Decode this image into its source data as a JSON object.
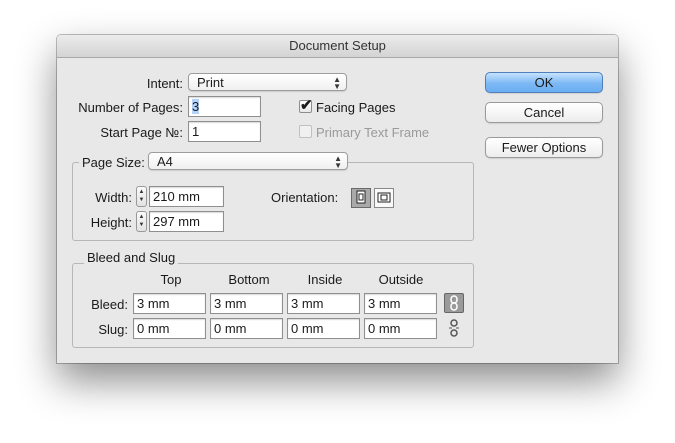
{
  "window": {
    "title": "Document Setup"
  },
  "intent": {
    "label": "Intent:",
    "value": "Print"
  },
  "pages": {
    "number_label": "Number of Pages:",
    "number_value": "3",
    "start_label": "Start Page №:",
    "start_value": "1"
  },
  "options": {
    "facing_pages": {
      "label": "Facing Pages",
      "checked": true
    },
    "primary_text_frame": {
      "label": "Primary Text Frame",
      "checked": false,
      "enabled": false
    }
  },
  "page_size": {
    "label": "Page Size:",
    "value": "A4",
    "width_label": "Width:",
    "width_value": "210 mm",
    "height_label": "Height:",
    "height_value": "297 mm",
    "orientation_label": "Orientation:"
  },
  "bleed_slug": {
    "title": "Bleed and Slug",
    "columns": [
      "Top",
      "Bottom",
      "Inside",
      "Outside"
    ],
    "bleed_label": "Bleed:",
    "bleed_values": [
      "3 mm",
      "3 mm",
      "3 mm",
      "3 mm"
    ],
    "slug_label": "Slug:",
    "slug_values": [
      "0 mm",
      "0 mm",
      "0 mm",
      "0 mm"
    ]
  },
  "buttons": {
    "ok": "OK",
    "cancel": "Cancel",
    "fewer_options": "Fewer Options"
  },
  "icons": {
    "popup_arrows": "up-down-arrows-icon",
    "stepper": "stepper-arrows-icon",
    "portrait": "portrait-orientation-icon",
    "landscape": "landscape-orientation-icon",
    "link_bleed": "chain-link-icon",
    "link_slug": "broken-chain-link-icon"
  },
  "colors": {
    "default_button": "#7cb8f4",
    "selection": "#b4d3f8",
    "window_bg": "#e8e8e8"
  }
}
